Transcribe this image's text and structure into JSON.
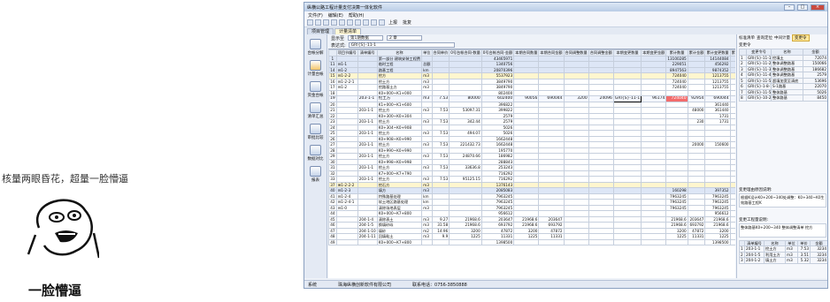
{
  "meme": {
    "caption": "核量两眼昏花，超量一脸懵逼",
    "label": "一脸懵逼"
  },
  "window": {
    "title": "纵横公路工程计量支付决算一体化软件"
  },
  "menu": [
    "文件(F)",
    "编辑(E)",
    "帮助(H)"
  ],
  "toolbar": {
    "extra": [
      "上报",
      "批复"
    ]
  },
  "tabs": [
    "项目管理",
    "计量清单"
  ],
  "leftnav": [
    "台帐分解",
    "计量台帐",
    "资金台帐",
    "清单汇总",
    "审批比较",
    "数据对比",
    "报表"
  ],
  "filters": {
    "scope": "显示至",
    "period": "第1期数据",
    "level": "2 章"
  },
  "formula": {
    "label": "表达式:",
    "value": "GRI{S}-11-1"
  },
  "grid": {
    "headers": [
      "项目节编号",
      "清单编号",
      "名称",
      "单位",
      "合同单价",
      "0号台帐合同-数量",
      "0号台帐合同-金额",
      "本期合同数量",
      "本期合同金额",
      "合同调整数量",
      "合同调整金额",
      "本期变更数量",
      "本期变更金额",
      "累计数量",
      "累计金额",
      "累计变更数量",
      "累计变更金额"
    ],
    "rows": [
      {
        "c": "r2",
        "n": "1",
        "cells": [
          "",
          "",
          "第一部分 建筑安装工程费",
          "",
          "",
          "",
          "43465971",
          "",
          "",
          "",
          "",
          "",
          "",
          "13100285",
          "",
          "14144084",
          "171455"
        ]
      },
      {
        "c": "r2",
        "n": "11",
        "cells": [
          "⊟1-1",
          "",
          "临时工程",
          "总额",
          "",
          "",
          "1340756",
          "",
          "",
          "",
          "",
          "",
          "",
          "229051",
          "",
          "456292",
          ""
        ]
      },
      {
        "c": "r2",
        "n": "14",
        "cells": [
          "⊟1-2",
          "",
          "路基工程",
          "km",
          "",
          "",
          "20870396",
          "",
          "",
          "",
          "",
          "",
          "",
          "8947563",
          "",
          "9874352",
          "106461"
        ]
      },
      {
        "c": "r3",
        "n": "15",
        "cells": [
          "⊟1-2-2",
          "",
          "挖方",
          "m3",
          "",
          "",
          "5537923",
          "",
          "",
          "",
          "",
          "",
          "",
          "724040",
          "",
          "1213755",
          "53696"
        ]
      },
      {
        "c": "r1",
        "n": "16",
        "cells": [
          "⊟1-2-2-1",
          "",
          "挖土方",
          "m3",
          "",
          "",
          "3849790",
          "",
          "",
          "",
          "",
          "",
          "",
          "724040",
          "",
          "1213755",
          "53696"
        ]
      },
      {
        "c": "r1",
        "n": "17",
        "cells": [
          "⊟1-2",
          "",
          "挖路基土方",
          "m3",
          "",
          "",
          "3849790",
          "",
          "",
          "",
          "",
          "",
          "",
          "724040",
          "",
          "1213755",
          "53696"
        ]
      },
      {
        "c": "r1",
        "n": "18",
        "cells": [
          "",
          "",
          "K0+000~K1+000",
          "",
          "",
          "",
          "802400",
          "",
          "",
          "",
          "",
          "",
          "",
          "",
          "",
          "",
          "24096"
        ]
      },
      {
        "c": "sel",
        "n": "19",
        "cells": [
          "",
          "203-1-1",
          "挖土方",
          "m3",
          "7.53",
          "80000",
          "602400",
          "90056",
          "690044",
          "3200",
          "24096",
          "GRI{S}-11-1",
          "96174",
          "724040",
          "92954",
          "690044",
          "3200"
        ]
      },
      {
        "c": "r1",
        "n": "20",
        "cells": [
          "",
          "",
          "K1+000~K1+600",
          "",
          "",
          "",
          "396822",
          "",
          "",
          "",
          "",
          "",
          "",
          "",
          "",
          "361440",
          "7530"
        ]
      },
      {
        "c": "r1",
        "n": "21",
        "cells": [
          "",
          "203-1-1",
          "挖土方",
          "m3",
          "7.53",
          "53097.31",
          "399822",
          "",
          "",
          "",
          "",
          "",
          "",
          "",
          "48000",
          "361440",
          "7530"
        ]
      },
      {
        "c": "r1",
        "n": "22",
        "cells": [
          "",
          "",
          "K0+300~K0+304",
          "",
          "",
          "",
          "2579",
          "",
          "",
          "",
          "",
          "",
          "",
          "",
          "",
          "1731",
          "22070"
        ]
      },
      {
        "c": "r1",
        "n": "23",
        "cells": [
          "",
          "203-1-1",
          "挖土方",
          "m3",
          "7.53",
          "342.44",
          "2579",
          "",
          "",
          "",
          "",
          "",
          "",
          "",
          "230",
          "1731",
          "22070"
        ]
      },
      {
        "c": "r1",
        "n": "24",
        "cells": [
          "",
          "",
          "K0+304~K0+908",
          "",
          "",
          "",
          "5026",
          "",
          "",
          "",
          "",
          "",
          "",
          "",
          "",
          "",
          ""
        ]
      },
      {
        "c": "r1",
        "n": "25",
        "cells": [
          "",
          "203-1-1",
          "挖土方",
          "m3",
          "7.53",
          "494.07",
          "5026",
          "",
          "",
          "",
          "",
          "",
          "",
          "",
          "",
          "",
          ""
        ]
      },
      {
        "c": "r1",
        "n": "26",
        "cells": [
          "",
          "",
          "K0+908~K0+990",
          "",
          "",
          "",
          "1662448",
          "",
          "",
          "",
          "",
          "",
          "",
          "",
          "",
          "",
          ""
        ]
      },
      {
        "c": "r1",
        "n": "27",
        "cells": [
          "",
          "203-1-1",
          "挖土方",
          "m3",
          "7.53",
          "221432.73",
          "1662448",
          "",
          "",
          "",
          "",
          "",
          "",
          "",
          "20000",
          "150600",
          ""
        ]
      },
      {
        "c": "r1",
        "n": "28",
        "cells": [
          "",
          "",
          "K0+990~K0+990",
          "",
          "",
          "",
          "195770",
          "",
          "",
          "",
          "",
          "",
          "",
          "",
          "",
          "",
          ""
        ]
      },
      {
        "c": "r1",
        "n": "29",
        "cells": [
          "",
          "203-1-1",
          "挖土方",
          "m3",
          "7.53",
          "24870.66",
          "186982",
          "",
          "",
          "",
          "",
          "",
          "",
          "",
          "",
          "",
          ""
        ]
      },
      {
        "c": "r1",
        "n": "30",
        "cells": [
          "",
          "",
          "K0+998~K0+998",
          "",
          "",
          "",
          "288843",
          "",
          "",
          "",
          "",
          "",
          "",
          "",
          "",
          "",
          ""
        ]
      },
      {
        "c": "r1",
        "n": "31",
        "cells": [
          "",
          "203-1-1",
          "挖土方",
          "m3",
          "7.53",
          "33636.8",
          "253243",
          "",
          "",
          "",
          "",
          "",
          "",
          "",
          "",
          "",
          ""
        ]
      },
      {
        "c": "r1",
        "n": "32",
        "cells": [
          "",
          "",
          "K7+000~K7+790",
          "",
          "",
          "",
          "716292",
          "",
          "",
          "",
          "",
          "",
          "",
          "",
          "",
          "",
          ""
        ]
      },
      {
        "c": "r1",
        "n": "33",
        "cells": [
          "",
          "203-1-1",
          "挖土方",
          "m3",
          "7.53",
          "95125.15",
          "716292",
          "",
          "",
          "",
          "",
          "",
          "",
          "",
          "",
          "",
          ""
        ]
      },
      {
        "c": "r3",
        "n": "37",
        "cells": [
          "⊞1-2-2-2",
          "",
          "挖石方",
          "m3",
          "",
          "",
          "1376143",
          "",
          "",
          "",
          "",
          "",
          "",
          "",
          "",
          "",
          ""
        ]
      },
      {
        "c": "r2",
        "n": "40",
        "cells": [
          "⊟1-2-3",
          "",
          "填方",
          "m3",
          "",
          "",
          "2085083",
          "",
          "",
          "",
          "",
          "",
          "",
          "160298",
          "",
          "397352",
          "92705"
        ]
      },
      {
        "c": "r1",
        "n": "41",
        "cells": [
          "⊟1-2-4",
          "",
          "特殊路基处理",
          "km",
          "",
          "",
          "7963245",
          "",
          "",
          "",
          "",
          "",
          "",
          "7963245",
          "",
          "7963245",
          ""
        ]
      },
      {
        "c": "r1",
        "n": "42",
        "cells": [
          "⊟1-2-4-1",
          "",
          "软土地区路基处理",
          "km",
          "",
          "",
          "7963245",
          "",
          "",
          "",
          "",
          "",
          "",
          "7963245",
          "",
          "7963245",
          ""
        ]
      },
      {
        "c": "r1",
        "n": "43",
        "cells": [
          "⊟1-0",
          "",
          "清除场地表层",
          "m3",
          "",
          "",
          "7963245",
          "",
          "",
          "",
          "",
          "",
          "",
          "7963245",
          "",
          "7963245",
          ""
        ]
      },
      {
        "c": "r1",
        "n": "44",
        "cells": [
          "",
          "",
          "K0+000~K7+800",
          "",
          "",
          "",
          "956612",
          "",
          "",
          "",
          "",
          "",
          "",
          "",
          "",
          "956612",
          ""
        ]
      },
      {
        "c": "r1",
        "n": "45",
        "cells": [
          "",
          "204-1-4",
          "清除表土",
          "m3",
          "9.27",
          "21968.6",
          "203647",
          "21968.6",
          "203647",
          "",
          "",
          "",
          "",
          "21968.6",
          "203647",
          "21968.6",
          "203647"
        ]
      },
      {
        "c": "r1",
        "n": "46",
        "cells": [
          "",
          "204-1-5",
          "换填砂砾",
          "m3",
          "31.58",
          "21968.6",
          "693792",
          "21968.6",
          "693792",
          "",
          "",
          "",
          "",
          "21968.6",
          "693792",
          "21968.6",
          "693792"
        ]
      },
      {
        "c": "r1",
        "n": "47",
        "cells": [
          "",
          "204-1-10",
          "填砂",
          "m2",
          "14.96",
          "3200",
          "47872",
          "3200",
          "47872",
          "",
          "",
          "",
          "",
          "3200",
          "47872",
          "3200",
          "47872"
        ]
      },
      {
        "c": "r1",
        "n": "48",
        "cells": [
          "",
          "204-1-11",
          "回填粘土",
          "m3",
          "9.9",
          "1225",
          "11331",
          "1225",
          "11331",
          "",
          "",
          "",
          "",
          "1225",
          "11331",
          "1225",
          "11331"
        ]
      },
      {
        "c": "r1",
        "n": "49",
        "cells": [
          "",
          "",
          "K0+000~K7+800",
          "",
          "",
          "",
          "1398500",
          "",
          "",
          "",
          "",
          "",
          "",
          "",
          "",
          "1398500",
          ""
        ]
      }
    ]
  },
  "right": {
    "tabs": [
      "标准清单",
      "查询定位",
      "中间计量",
      "变更令"
    ],
    "title": "变更令",
    "headers": [
      "变更令号",
      "名称",
      "金额"
    ],
    "rows": [
      [
        "1",
        "GRI{S}-11-1",
        "挖填土",
        "72074"
      ],
      [
        "2",
        "GRI{S}-11-2",
        "整体调整路基",
        "150066"
      ],
      [
        "3",
        "GRI{S}-11-3",
        "整体调整路基",
        "186682"
      ],
      [
        "4",
        "GRI{S}-11-4",
        "整体调整路基",
        "2579"
      ],
      [
        "5",
        "GRI{S}-11-5",
        "超填加宽至清底",
        "53696"
      ],
      [
        "6",
        "GRI{S}-1-8-1",
        "S-1路基",
        "22070"
      ],
      [
        "7",
        "GRI{S}-11-5",
        "整体路基",
        "5026"
      ],
      [
        "8",
        "GRI{S}-10-2",
        "整体路基",
        "8450"
      ]
    ],
    "note1_label": "变更理由原因说明:",
    "note1_value": "根据K设计K0+200~340处调整：K0+340~K0生效路基工程K",
    "note2_label": "变更工程量说明:",
    "note2_value": "整体路基K0+200~340 整体调整清单 挖方",
    "sub_headers": [
      "清单编号",
      "名称",
      "单位",
      "单价",
      "金额"
    ],
    "sub_rows": [
      [
        "1",
        "203-1-1",
        "挖土方",
        "m3",
        "7.53",
        "3234"
      ],
      [
        "2",
        "204-1-5",
        "利用土方",
        "m3",
        "3.51",
        "3234"
      ],
      [
        "3",
        "204-1-2",
        "填土方",
        "m3",
        "5.32",
        "3234"
      ]
    ]
  },
  "status": {
    "user": "系统",
    "company": "珠海纵横创新软件有限公司",
    "phone": "联系电话：0756-3850888"
  }
}
